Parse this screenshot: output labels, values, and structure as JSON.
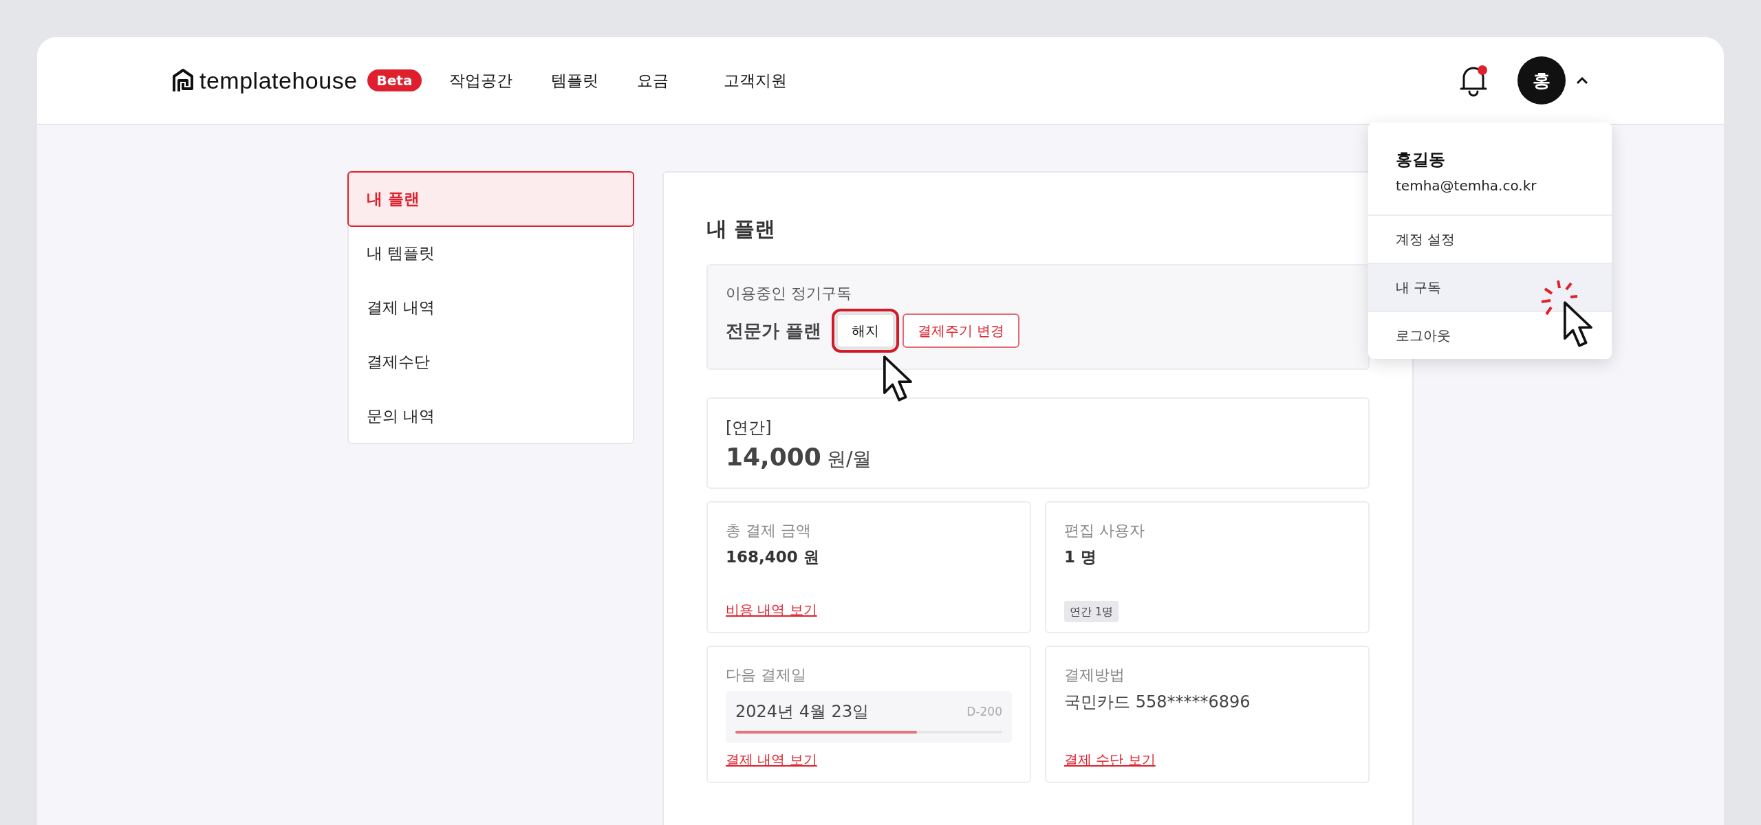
{
  "header": {
    "logo": "templatehouse",
    "badge": "Beta",
    "nav": [
      {
        "label": "작업공간"
      },
      {
        "label": "템플릿"
      },
      {
        "label": "요금"
      },
      {
        "label": "고객지원"
      }
    ],
    "notification": {
      "unread": true
    },
    "avatar": "홍",
    "menu_open": true
  },
  "user_menu": {
    "name": "홍길동",
    "email": "temha@temha.co.kr",
    "items": [
      {
        "label": "계정 설정",
        "selected": false
      },
      {
        "label": "내 구독",
        "selected": true
      },
      {
        "label": "로그아웃",
        "selected": false
      }
    ]
  },
  "sidebar": {
    "items": [
      {
        "label": "내 플랜",
        "selected": true
      },
      {
        "label": "내 템플릿",
        "selected": false
      },
      {
        "label": "결제 내역",
        "selected": false
      },
      {
        "label": "결제수단",
        "selected": false
      },
      {
        "label": "문의 내역",
        "selected": false
      }
    ]
  },
  "plan": {
    "title": "내 플랜",
    "subscription_label": "이용중인 정기구독",
    "plan_name": "전문가 플랜",
    "buttons": [
      {
        "label": "해지",
        "kind": "plain",
        "highlighted": true
      },
      {
        "label": "결제주기 변경",
        "kind": "outline",
        "highlighted": false
      }
    ]
  },
  "price": {
    "period": "[연간]",
    "amount": "14,000",
    "unit": "원/월"
  },
  "cards": [
    {
      "kind": "amount",
      "label": "총 결제 금액",
      "value": "168,400 원",
      "link": "비용 내역 보기"
    },
    {
      "kind": "tag",
      "label": "편집 사용자",
      "value": "1 명",
      "tag": "연간 1명"
    },
    {
      "kind": "date",
      "label": "다음 결제일",
      "value": "2024년 4월 23일",
      "countdown": "D-200",
      "level": 0.68,
      "link": "결제 내역 보기"
    },
    {
      "kind": "method",
      "label": "결제방법",
      "value": "국민카드 558*****6896",
      "link": "결제 수단 보기"
    }
  ]
}
